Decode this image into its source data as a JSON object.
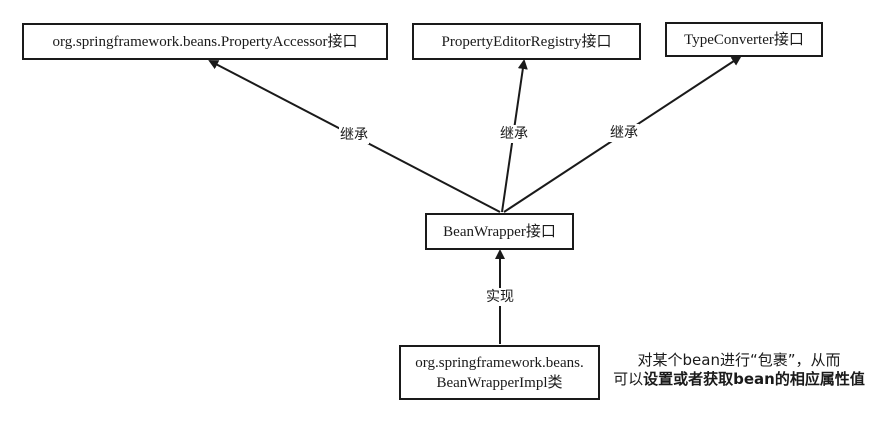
{
  "nodes": {
    "property_accessor": "org.springframework.beans.PropertyAccessor接口",
    "property_editor_registry": "PropertyEditorRegistry接口",
    "type_converter": "TypeConverter接口",
    "bean_wrapper": "BeanWrapper接口",
    "bean_wrapper_impl_line1": "org.springframework.beans.",
    "bean_wrapper_impl_line2": "BeanWrapperImpl类"
  },
  "edges": {
    "inherit_label_1": "继承",
    "inherit_label_2": "继承",
    "inherit_label_3": "继承",
    "implement_label": "实现"
  },
  "note": {
    "line1": "对某个bean进行“包裹”，从而",
    "line2_prefix": "可以",
    "line2_bold": "设置或者获取bean的相应属性值"
  },
  "colors": {
    "stroke": "#1a1a1a",
    "background": "#ffffff"
  }
}
